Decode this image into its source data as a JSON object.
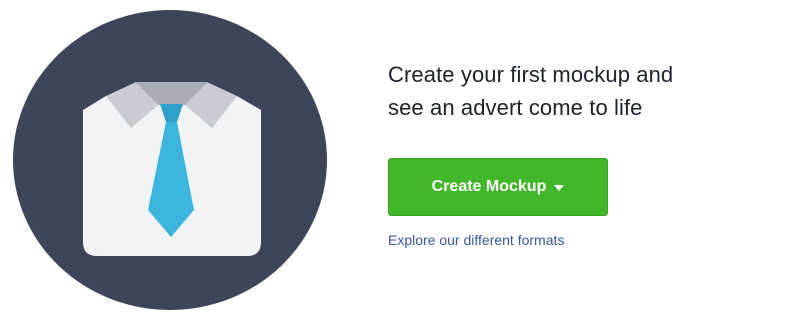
{
  "hero": {
    "illustration_icon": "shirt-tie-icon",
    "headline_line1": "Create your first mockup and",
    "headline_line2": "see an advert come to life",
    "button_label": "Create Mockup",
    "button_icon": "caret-down-icon",
    "link_text": "Explore our different formats"
  },
  "colors": {
    "circle": "#3c4658",
    "shirt": "#f2f3f5",
    "collar": "#c9cdd3",
    "tie": "#3db4de",
    "button": "#42b72a",
    "link": "#365899",
    "headline": "#1d2129"
  }
}
